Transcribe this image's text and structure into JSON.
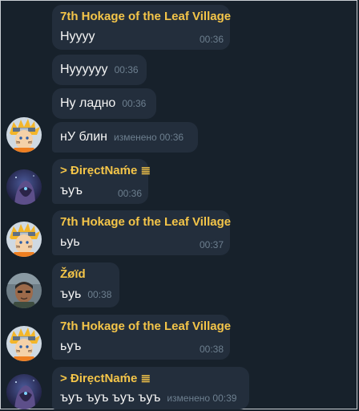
{
  "messages": [
    {
      "sender": "7th Hokage of the Leaf Village",
      "text": "Hyyyy",
      "time": "00:36"
    },
    {
      "text": "Hyyyyyy",
      "time": "00:36"
    },
    {
      "text": "Ну ладно",
      "time": "00:36"
    },
    {
      "text": "нУ блин",
      "time": "изменено 00:36"
    },
    {
      "sender": "> ĐirẹctNaḿe ≣",
      "text": "ъуъ",
      "time": "00:36"
    },
    {
      "sender": "7th Hokage of the Leaf Village",
      "text": "ьуь",
      "time": "00:37"
    },
    {
      "sender": "Žøïd",
      "text": "ъуь",
      "time": "00:38"
    },
    {
      "sender": "7th Hokage of the Leaf Village",
      "text": "ьуъ",
      "time": "00:38"
    },
    {
      "sender": "> ĐirẹctNaḿe ≣",
      "text": "ъуъ ъуъ ъуъ ъуъ",
      "time": "изменено 00:39"
    }
  ],
  "colors": {
    "background": "#17212b",
    "bubble": "#232e3c",
    "sender": "#f4c549",
    "text": "#f5f5f5",
    "time": "#6d7f8f"
  },
  "avatars": [
    "naruto-avatar",
    "directname-avatar",
    "zoid-avatar"
  ]
}
